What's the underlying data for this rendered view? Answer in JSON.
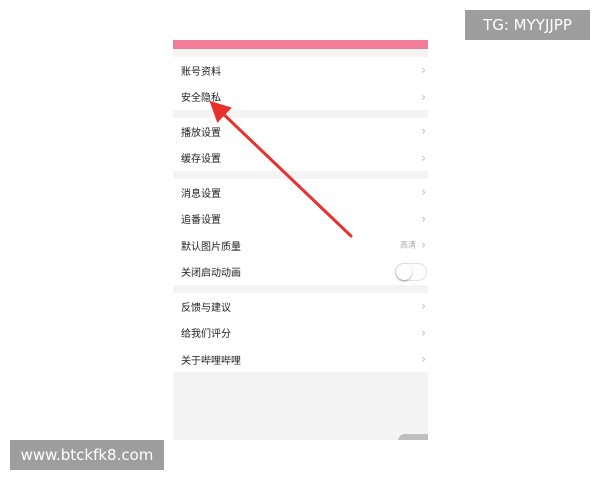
{
  "watermark_top": "TG: MYYJJPP",
  "watermark_bottom": "www.btckfk8.com",
  "colors": {
    "accent": "#f27d99",
    "arrow": "#e8302c"
  },
  "settings": {
    "groups": [
      {
        "items": [
          {
            "label": "账号资料"
          },
          {
            "label": "安全隐私"
          }
        ]
      },
      {
        "items": [
          {
            "label": "播放设置"
          },
          {
            "label": "缓存设置"
          }
        ]
      },
      {
        "items": [
          {
            "label": "消息设置"
          },
          {
            "label": "追番设置"
          },
          {
            "label": "默认图片质量",
            "value": "高清"
          },
          {
            "label": "关闭启动动画",
            "toggle": false
          }
        ]
      },
      {
        "items": [
          {
            "label": "反馈与建议"
          },
          {
            "label": "给我们评分"
          },
          {
            "label": "关于哔哩哔哩"
          }
        ]
      }
    ],
    "chevron_icon": "chevron-right-icon"
  }
}
